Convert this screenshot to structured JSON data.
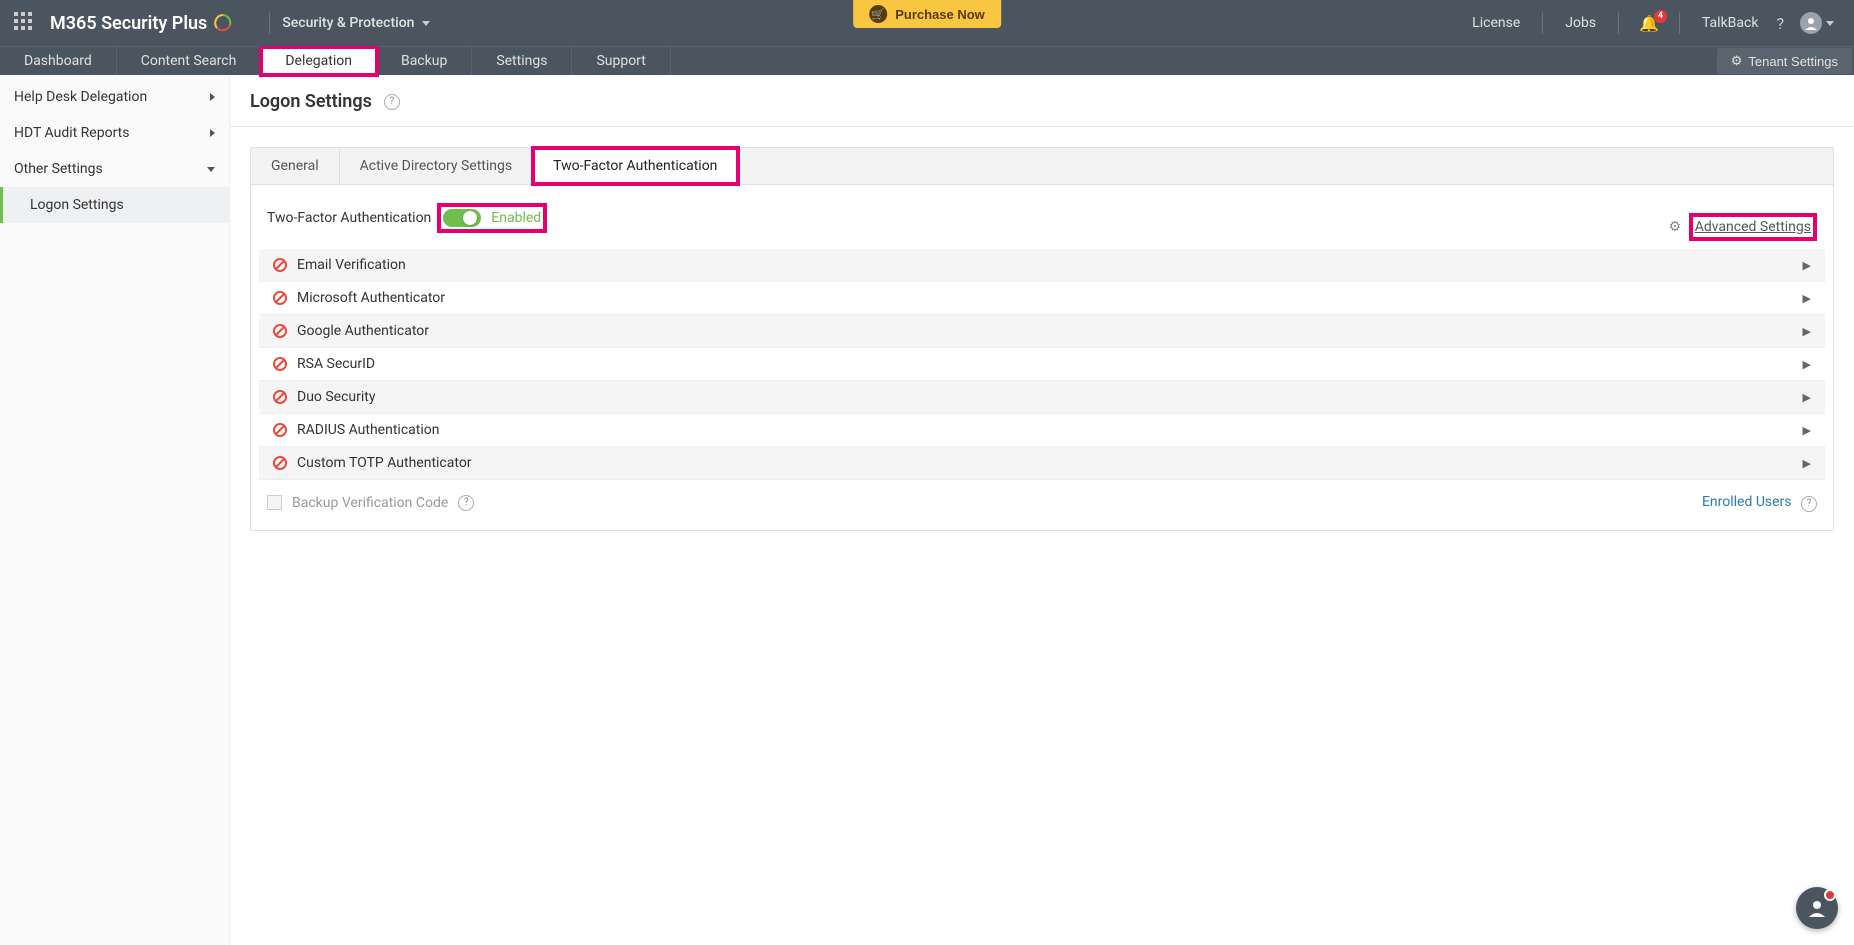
{
  "topbar": {
    "logo": "M365 Security Plus",
    "breadcrumb": "Security & Protection",
    "purchase": "Purchase Now",
    "links": {
      "license": "License",
      "jobs": "Jobs",
      "talkback": "TalkBack"
    },
    "notif_count": "4"
  },
  "navbar": {
    "tabs": [
      "Dashboard",
      "Content Search",
      "Delegation",
      "Backup",
      "Settings",
      "Support"
    ],
    "active_index": 2,
    "tenant_btn": "Tenant Settings"
  },
  "sidebar": {
    "items": [
      {
        "label": "Help Desk Delegation",
        "expandable": true
      },
      {
        "label": "HDT Audit Reports",
        "expandable": true
      },
      {
        "label": "Other Settings",
        "expandable": true,
        "expanded": true
      }
    ],
    "sub": {
      "label": "Logon Settings"
    }
  },
  "page": {
    "title": "Logon Settings"
  },
  "tabs": {
    "items": [
      "General",
      "Active Directory Settings",
      "Two-Factor Authentication"
    ],
    "active_index": 2
  },
  "tfa": {
    "label": "Two-Factor Authentication",
    "status": "Enabled",
    "advanced": "Advanced Settings"
  },
  "methods": [
    "Email Verification",
    "Microsoft Authenticator",
    "Google Authenticator",
    "RSA SecurID",
    "Duo Security",
    "RADIUS Authentication",
    "Custom TOTP Authenticator"
  ],
  "footer": {
    "backup_label": "Backup Verification Code",
    "enrolled": "Enrolled Users"
  }
}
